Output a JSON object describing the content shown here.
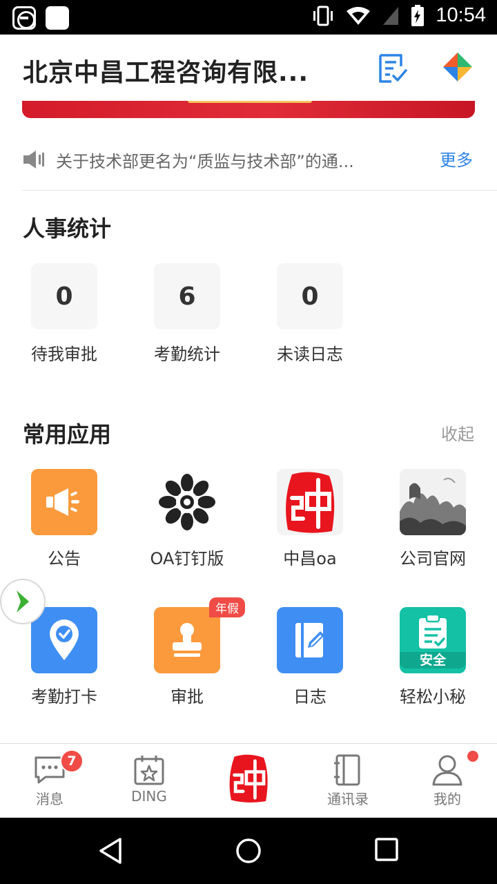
{
  "status_bar": {
    "time": "10:54"
  },
  "header": {
    "title": "北京中昌工程咨询有限..."
  },
  "notice": {
    "text": "关于技术部更名为“质监与技术部”的通...",
    "more_label": "更多"
  },
  "hr_stats": {
    "title": "人事统计",
    "items": [
      {
        "value": "0",
        "label": "待我审批"
      },
      {
        "value": "6",
        "label": "考勤统计"
      },
      {
        "value": "0",
        "label": "未读日志"
      }
    ]
  },
  "apps": {
    "title": "常用应用",
    "toggle_label": "收起",
    "items": [
      {
        "label": "公告",
        "icon": "megaphone-icon",
        "color": "#fa9a3c"
      },
      {
        "label": "OA钉钉版",
        "icon": "flower-logo-icon",
        "color": "#ffffff"
      },
      {
        "label": "中昌oa",
        "icon": "seal-logo-icon",
        "color": "#e8151e"
      },
      {
        "label": "公司官网",
        "icon": "landscape-painting-icon",
        "color": "#888888"
      },
      {
        "label": "考勤打卡",
        "icon": "location-pin-icon",
        "color": "#3f8ef3"
      },
      {
        "label": "审批",
        "icon": "stamp-icon",
        "color": "#fa9a3c",
        "tag": "年假"
      },
      {
        "label": "日志",
        "icon": "notebook-pen-icon",
        "color": "#3f8ef3"
      },
      {
        "label": "轻松小秘",
        "icon": "clipboard-check-icon",
        "color": "#14c1a5",
        "tile_text": "安全"
      }
    ]
  },
  "bottom_nav": {
    "items": [
      {
        "label": "消息",
        "icon": "chat-bubble-icon",
        "badge": "7"
      },
      {
        "label": "DING",
        "icon": "ding-calendar-icon"
      },
      {
        "label": "",
        "icon": "seal-logo-icon"
      },
      {
        "label": "通讯录",
        "icon": "contacts-book-icon"
      },
      {
        "label": "我的",
        "icon": "person-icon",
        "dot": true
      }
    ]
  },
  "colors": {
    "accent": "#2d84e5",
    "badge_red": "#f04b46",
    "banner_red": "#d41b2b"
  }
}
